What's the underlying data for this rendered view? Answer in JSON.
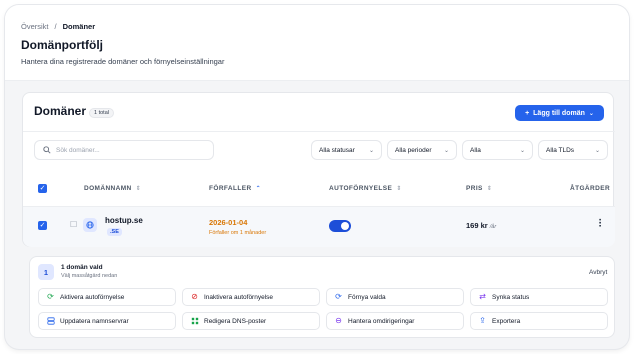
{
  "breadcrumb": {
    "items": [
      "Översikt",
      "/",
      "Domäner"
    ]
  },
  "page": {
    "title": "Domänportfölj",
    "subtitle": "Hantera dina registrerade domäner och förnyelseinställningar"
  },
  "card": {
    "title": "Domäner",
    "total_badge": "1 total",
    "add_button": "Lägg till domän"
  },
  "filters": {
    "search_placeholder": "Sök domäner...",
    "status": "Alla statusar",
    "period": "Alla perioder",
    "renewal": "Alla",
    "tld": "Alla TLDs"
  },
  "table": {
    "columns": [
      "DOMÄNNAMN",
      "FÖRFALLER",
      "AUTOFÖRNYELSE",
      "PRIS",
      "ÅTGÄRDER"
    ],
    "rows": [
      {
        "name": "hostup.se",
        "tld": ".SE",
        "expires": "2026-01-04",
        "expires_note": "Förfaller om 1 månader",
        "auto_renew": true,
        "price": "169 kr",
        "price_period": "/år"
      }
    ]
  },
  "bulk": {
    "count": "1",
    "title": "1 domän vald",
    "subtitle": "Välj massåtgärd nedan",
    "cancel": "Avbryt",
    "actions": [
      {
        "label": "Aktivera autoförnyelse",
        "icon": "refresh-icon",
        "color": "#16a34a"
      },
      {
        "label": "Inaktivera autoförnyelse",
        "icon": "ban-icon",
        "color": "#dc2626"
      },
      {
        "label": "Förnya valda",
        "icon": "refresh-icon",
        "color": "#2563eb"
      },
      {
        "label": "Synka status",
        "icon": "sync-icon",
        "color": "#7c3aed"
      },
      {
        "label": "Uppdatera namnservrar",
        "icon": "server-icon",
        "color": "#2563eb"
      },
      {
        "label": "Redigera DNS-poster",
        "icon": "dns-icon",
        "color": "#16a34a"
      },
      {
        "label": "Hantera omdirigeringar",
        "icon": "redirect-icon",
        "color": "#7c3aed"
      },
      {
        "label": "Exportera",
        "icon": "export-icon",
        "color": "#2563eb"
      }
    ]
  },
  "colors": {
    "accent": "#2563eb",
    "warning": "#d97706"
  }
}
